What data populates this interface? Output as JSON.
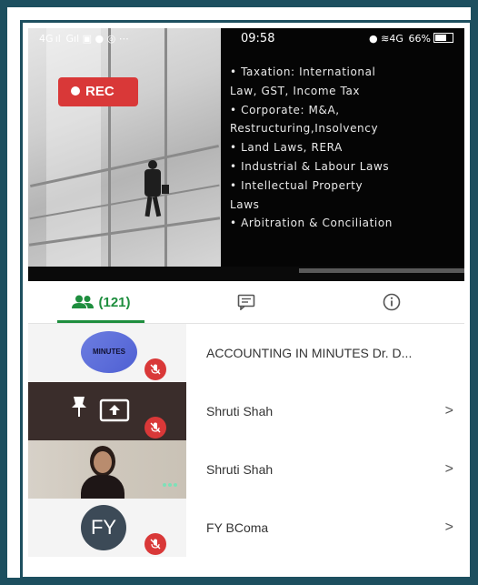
{
  "status_bar": {
    "left": "4G ıl  Gıl  ▣  ●  ◎  ⋯",
    "time": "09:58",
    "right": "●  ≋4G  66%"
  },
  "video": {
    "rec_label": "REC",
    "bullets": [
      "• Taxation: International",
      "  Law, GST, Income Tax",
      "• Corporate: M&A,",
      "  Restructuring,Insolvency",
      "• Land Laws, RERA",
      "• Industrial & Labour Laws",
      "• Intellectual Property",
      "  Laws",
      "• Arbitration & Conciliation"
    ]
  },
  "tabs": {
    "people_count": "(121)",
    "active": "people"
  },
  "participants": [
    {
      "name": "ACCOUNTING IN MINUTES Dr. D...",
      "avatar_text": "MINUTES",
      "muted": true,
      "chevron": ""
    },
    {
      "name": "Shruti Shah",
      "muted": true,
      "chevron": ">"
    },
    {
      "name": "Shruti Shah",
      "muted": false,
      "chevron": ">"
    },
    {
      "name": "FY BComa",
      "avatar_text": "FY",
      "muted": true,
      "chevron": ">"
    }
  ],
  "colors": {
    "accent": "#1e8e3e",
    "rec": "#d93838",
    "frame": "#1d4f5f"
  }
}
